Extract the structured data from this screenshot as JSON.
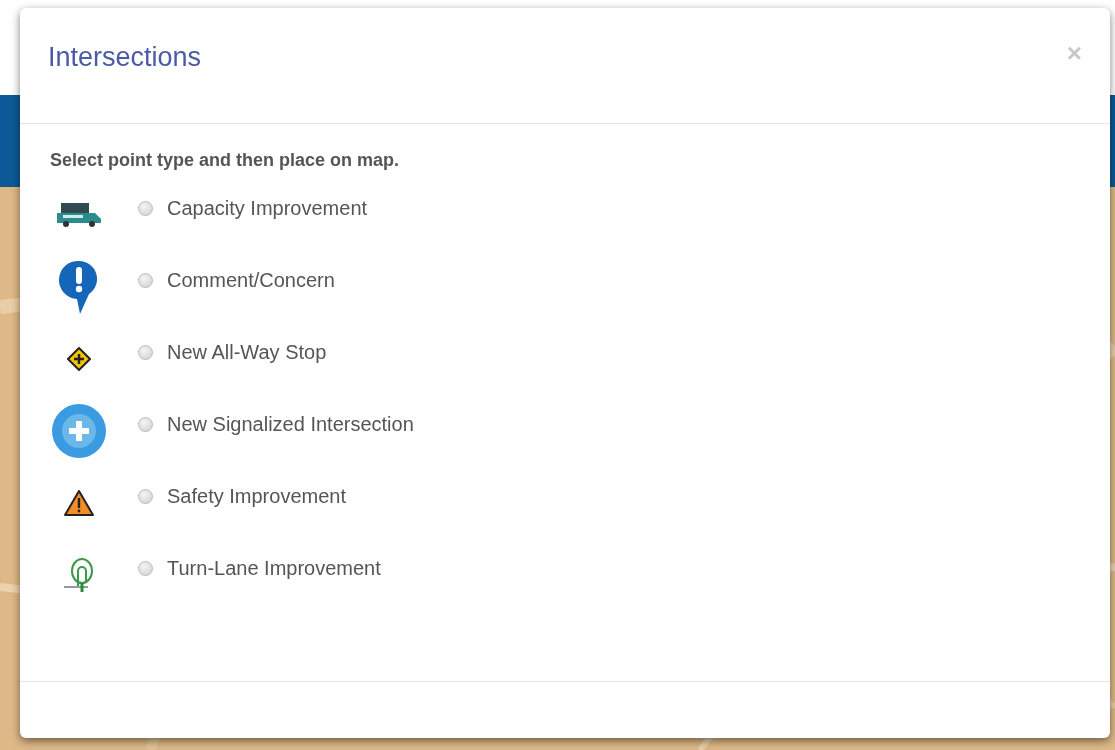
{
  "dialog": {
    "title": "Intersections",
    "close": "×",
    "instruction": "Select point type and then place on map.",
    "options": [
      {
        "label": "Capacity Improvement",
        "selected": false
      },
      {
        "label": "Comment/Concern",
        "selected": false
      },
      {
        "label": "New All-Way Stop",
        "selected": false
      },
      {
        "label": "New Signalized Intersection",
        "selected": false
      },
      {
        "label": "Safety Improvement",
        "selected": false
      },
      {
        "label": "Turn-Lane Improvement",
        "selected": false
      }
    ]
  }
}
